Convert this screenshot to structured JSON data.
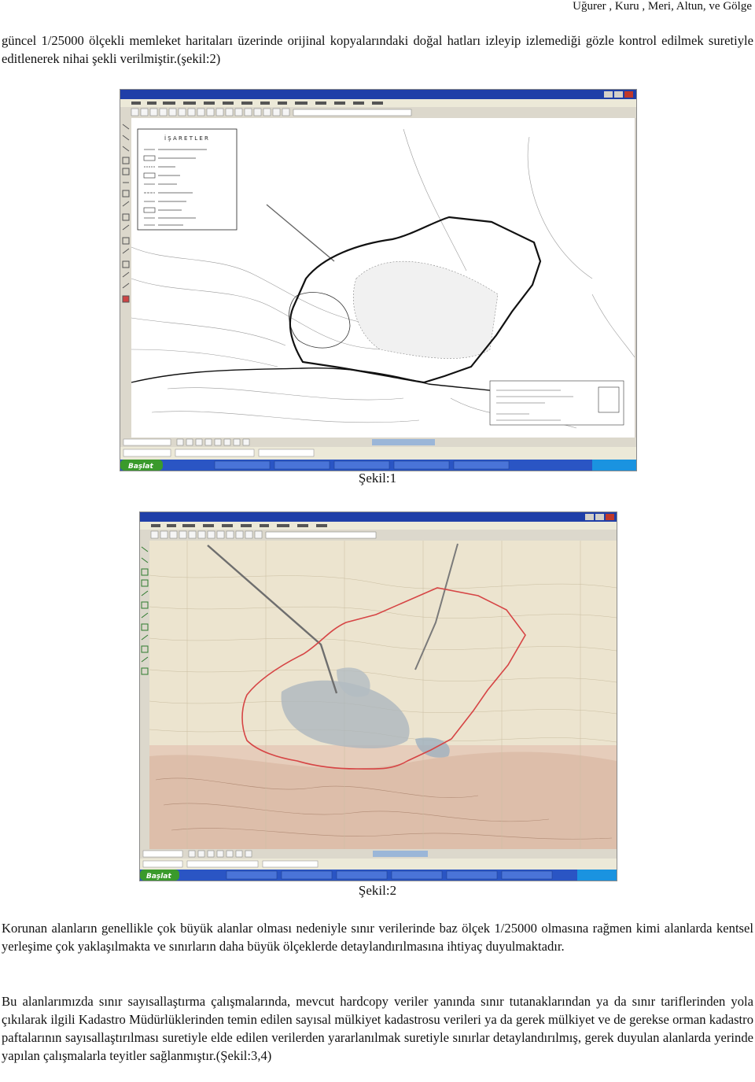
{
  "header": {
    "authors": "Uğurer , Kuru , Meri, Altun, ve Gölge"
  },
  "paragraphs": {
    "p1": "güncel 1/25000 ölçekli memleket haritaları üzerinde orijinal kopyalarındaki doğal hatları izleyip izlemediği gözle kontrol edilmek suretiyle editlenerek nihai şekli verilmiştir.(şekil:2)",
    "p2": "Korunan alanların genellikle çok büyük alanlar olması nedeniyle sınır verilerinde baz ölçek 1/25000 olmasına rağmen kimi alanlarda kentsel yerleşime çok yaklaşılmakta ve sınırların daha büyük ölçeklerde detaylandırılmasına ihtiyaç duyulmaktadır.",
    "p3": "Bu alanlarımızda sınır sayısallaştırma çalışmalarında, mevcut hardcopy veriler yanında sınır tutanaklarından ya da sınır tariflerinden yola çıkılarak ilgili Kadastro Müdürlüklerinden temin edilen sayısal mülkiyet kadastrosu verileri ya da gerek mülkiyet ve de gerekse orman kadastro paftalarının sayısallaştırılması suretiyle elde edilen verilerden yararlanılmak suretiyle sınırlar detaylandırılmış, gerek duyulan alanlarda yerinde yapılan çalışmalarla teyitler sağlanmıştır.(Şekil:3,4)"
  },
  "figures": {
    "fig1": {
      "caption": "Şekil:1",
      "start_label": "Başlat",
      "legend_title": "İ Ş A R E T L E R",
      "colors": {
        "titlebar": "#1f3fa8",
        "taskbar": "#2a55c4",
        "start": "#3a9a2c",
        "boundary": "#111111",
        "map_bg": "#ffffff"
      }
    },
    "fig2": {
      "caption": "Şekil:2",
      "start_label": "Başlat",
      "colors": {
        "titlebar": "#1f3fa8",
        "taskbar": "#2a55c4",
        "start": "#3a9a2c",
        "boundary": "#d64545",
        "map_bg": "#ece4cf"
      }
    }
  }
}
